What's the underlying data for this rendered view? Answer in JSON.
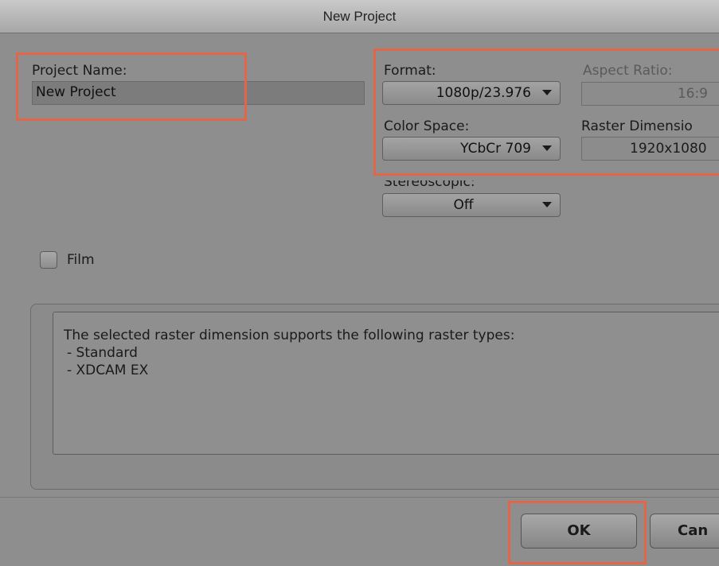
{
  "window": {
    "title": "New Project"
  },
  "project": {
    "name_label": "Project Name:",
    "name_value": "New Project"
  },
  "format": {
    "label": "Format:",
    "value": "1080p/23.976"
  },
  "aspect_ratio": {
    "label": "Aspect Ratio:",
    "value": "16:9"
  },
  "color_space": {
    "label": "Color Space:",
    "value": "YCbCr 709"
  },
  "raster": {
    "label": "Raster Dimensio",
    "value": "1920x1080"
  },
  "stereoscopic": {
    "label": "Stereoscopic:",
    "value": "Off"
  },
  "film": {
    "label": "Film",
    "checked": false
  },
  "info": {
    "lines": [
      "The selected raster dimension supports the following raster types:",
      "- Standard",
      "- XDCAM EX"
    ]
  },
  "buttons": {
    "ok": "OK",
    "cancel": "Can"
  },
  "colors": {
    "highlight": "#e2664a",
    "dialog_bg": "#8e8e8e"
  }
}
